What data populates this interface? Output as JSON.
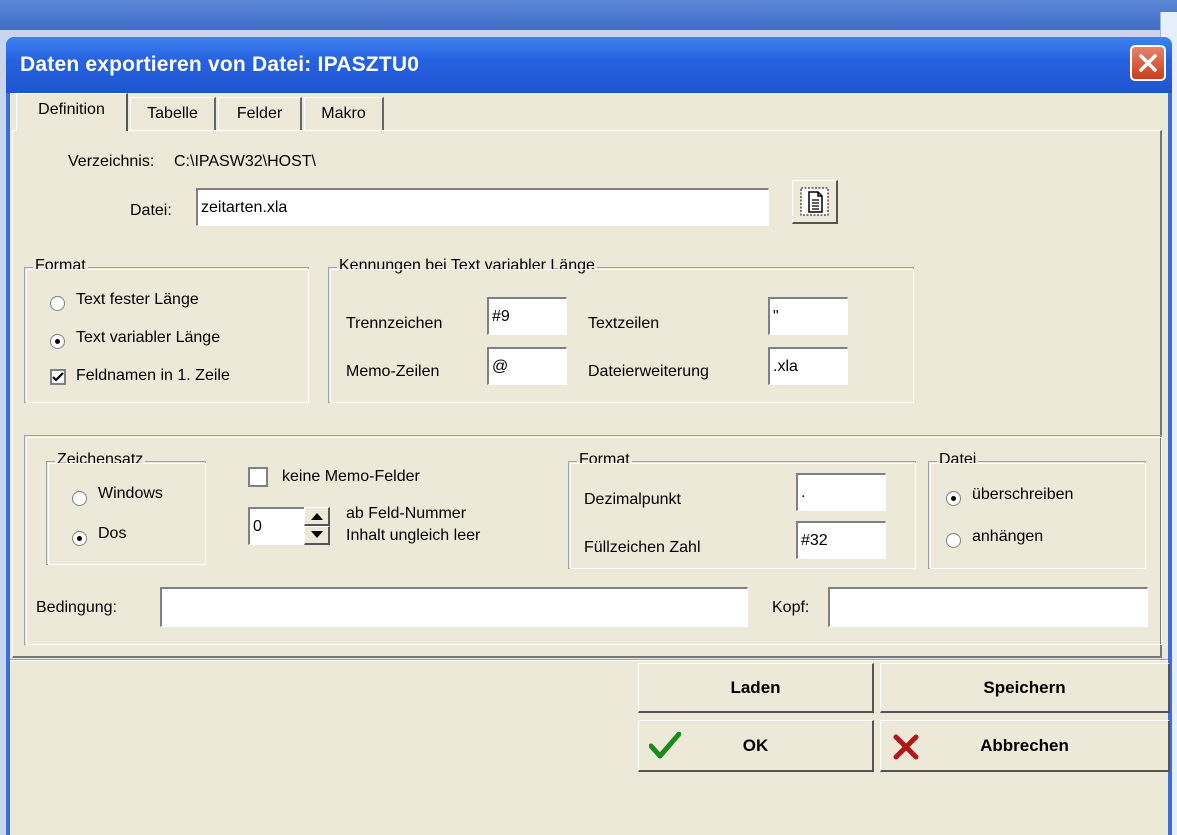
{
  "window": {
    "title": "Daten exportieren von Datei: IPASZTU0"
  },
  "tabs": [
    "Definition",
    "Tabelle",
    "Felder",
    "Makro"
  ],
  "definition": {
    "verzeichnis_label": "Verzeichnis:",
    "verzeichnis_value": "C:\\IPASW32\\HOST\\",
    "datei_label": "Datei:",
    "datei_value": "zeitarten.xla",
    "format_group": {
      "title": "Format",
      "options": [
        "Text fester Länge",
        "Text variabler Länge"
      ],
      "selected": "Text variabler Länge",
      "checkbox_label": "Feldnamen in 1. Zeile",
      "checkbox_checked": true
    },
    "kennungen_group": {
      "title": "Kennungen  bei Text variabler Länge",
      "trennzeichen_label": "Trennzeichen",
      "trennzeichen_value": "#9",
      "textzeilen_label": "Textzeilen",
      "textzeilen_value": "\"",
      "memo_label": "Memo-Zeilen",
      "memo_value": "@",
      "dateierweiterung_label": "Dateierweiterung",
      "dateierweiterung_value": ".xla"
    },
    "zeichensatz_group": {
      "title": "Zeichensatz",
      "options": [
        "Windows",
        "Dos"
      ],
      "selected": "Dos"
    },
    "keine_memo_label": "keine Memo-Felder",
    "keine_memo_checked": false,
    "feldnummer_value": "0",
    "feldnummer_label_1": "ab Feld-Nummer",
    "feldnummer_label_2": "Inhalt ungleich leer",
    "format2_group": {
      "title": "Format",
      "dezimal_label": "Dezimalpunkt",
      "dezimal_value": ".",
      "fuell_label": "Füllzeichen Zahl",
      "fuell_value": "#32"
    },
    "datei_group": {
      "title": "Datei",
      "options": [
        "überschreiben",
        "anhängen"
      ],
      "selected": "überschreiben"
    },
    "bedingung_label": "Bedingung:",
    "bedingung_value": "",
    "kopf_label": "Kopf:",
    "kopf_value": ""
  },
  "buttons": {
    "laden": "Laden",
    "speichern": "Speichern",
    "ok": "OK",
    "abbrechen": "Abbrechen"
  },
  "colors": {
    "title_bar": "#2763e0",
    "dialog_bg": "#ece9d8",
    "close_red": "#cb3c1c",
    "ok_green": "#1a8a1a",
    "cancel_red": "#b01818"
  },
  "icons": [
    "close-icon",
    "file-browse-icon",
    "checkmark-icon",
    "x-icon",
    "spinner-up-icon",
    "spinner-down-icon"
  ]
}
